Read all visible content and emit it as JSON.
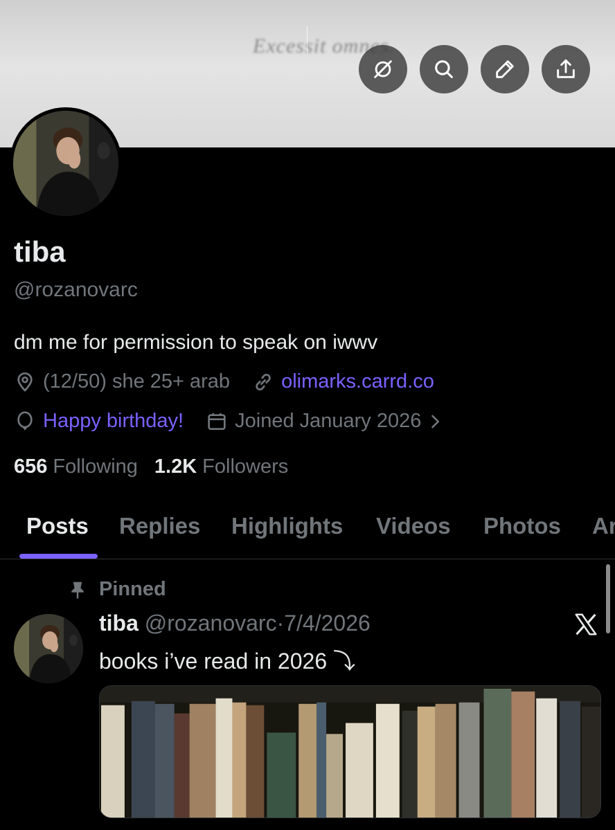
{
  "banner": {
    "text": "Excessit omnes.",
    "actions": [
      {
        "name": "unlink-icon"
      },
      {
        "name": "search-icon"
      },
      {
        "name": "edit-icon"
      },
      {
        "name": "share-icon"
      }
    ]
  },
  "profile": {
    "name": "tiba",
    "handle": "@rozanovarc",
    "bio": "dm me for permission to speak on iwwv",
    "location": "(12/50) she 25+ arab",
    "website": "olimarks.carrd.co",
    "birthday": "Happy birthday!",
    "joined": "Joined January 2026",
    "following_count": "656",
    "following_label": "Following",
    "followers_count": "1.2K",
    "followers_label": "Followers"
  },
  "tabs": [
    "Posts",
    "Replies",
    "Highlights",
    "Videos",
    "Photos",
    "Articles"
  ],
  "active_tab": "Posts",
  "post": {
    "pinned_label": "Pinned",
    "author_name": "tiba",
    "author_handle": "@rozanovarc",
    "separator": "·",
    "date": "7/4/2026",
    "text": "books i’ve read in 2026 ⤵︎",
    "source": "X"
  },
  "colors": {
    "accent": "#7b61ff",
    "text_primary": "#e7e9ea",
    "text_secondary": "#71767b",
    "background": "#000000"
  }
}
